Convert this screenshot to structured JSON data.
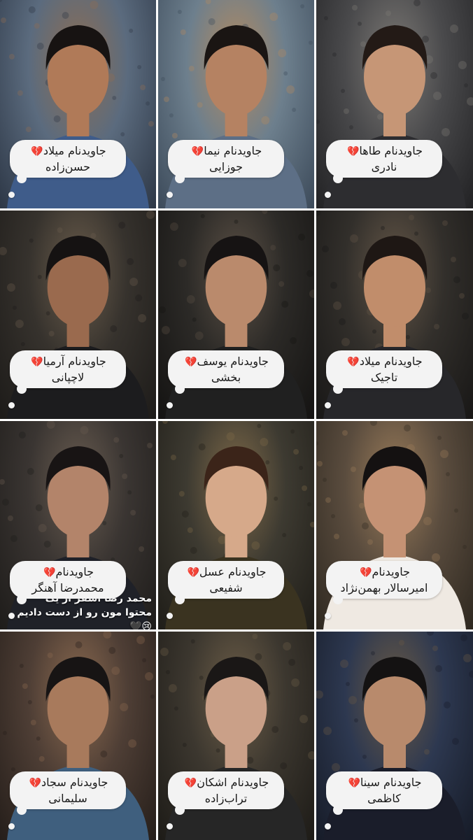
{
  "heart_emoji": "💔",
  "colors": {
    "heart": "#d21f2b",
    "bubble": "#f3f3f3",
    "text": "#1a1a1a"
  },
  "tiles": [
    {
      "line1": "جاویدنام میلاد",
      "line2": "حسن‌زاده",
      "bg": [
        "#5b6b7e",
        "#8e6e52",
        "#2d3746"
      ],
      "skin": "#b07a58",
      "hair": "#171312",
      "shirt": "#3f5c8a"
    },
    {
      "line1": "جاویدنام نیما",
      "line2": "جوزایی",
      "bg": [
        "#6d7f8d",
        "#b48a5e",
        "#3c4a5a"
      ],
      "skin": "#b58262",
      "hair": "#1a1513",
      "shirt": "#5d6f86"
    },
    {
      "line1": "جاویدنام طاها",
      "line2": "نادری",
      "bg": [
        "#4a4a4c",
        "#7d7a76",
        "#222224"
      ],
      "skin": "#c69676",
      "hair": "#231a16",
      "shirt": "#2d2d30"
    },
    {
      "line1": "جاویدنام آرمیا",
      "line2": "لاچپانی",
      "bg": [
        "#36322d",
        "#6b5d4c",
        "#1d1b19"
      ],
      "skin": "#9a6a4e",
      "hair": "#151212",
      "shirt": "#1c1c1e"
    },
    {
      "line1": "جاویدنام یوسف",
      "line2": "بخشی",
      "bg": [
        "#2c2a27",
        "#5c5146",
        "#141312"
      ],
      "skin": "#ba8a6c",
      "hair": "#161313",
      "shirt": "#202020"
    },
    {
      "line1": "جاویدنام میلاد",
      "line2": "تاجیک",
      "bg": [
        "#322f2b",
        "#655748",
        "#181716"
      ],
      "skin": "#c18d6b",
      "hair": "#1e1714",
      "shirt": "#27272a"
    },
    {
      "line1": "جاویدنام",
      "line2": "محمدرضا آهنگر",
      "bg": [
        "#3a3532",
        "#6a5d51",
        "#1e1c1a"
      ],
      "skin": "#b3846a",
      "hair": "#181414",
      "shirt": "#1f2128",
      "overlay": [
        "محمد رضا اسفر از یک",
        "محتوا مون رو از دست دادیم 😢🖤"
      ]
    },
    {
      "line1": "جاویدنام عسل",
      "line2": "شفیعی",
      "bg": [
        "#3d3a31",
        "#7f6a49",
        "#1f1d18"
      ],
      "skin": "#d6a98a",
      "hair": "#3b2419",
      "shirt": "#3a3320"
    },
    {
      "line1": "جاویدنام",
      "line2": "امیرسالار بهمن‌نژاد",
      "bg": [
        "#5a4c3e",
        "#9a7c5a",
        "#2e2820"
      ],
      "skin": "#c59274",
      "hair": "#141111",
      "shirt": "#efe9e2"
    },
    {
      "line1": "جاویدنام سجاد",
      "line2": "سلیمانی",
      "bg": [
        "#4e3e35",
        "#8b6a50",
        "#251e1a"
      ],
      "skin": "#a87a5c",
      "hair": "#171414",
      "shirt": "#3f5f7e"
    },
    {
      "line1": "جاویدنام اشکان",
      "line2": "تراب‌زاده",
      "bg": [
        "#3c372f",
        "#6d5e48",
        "#1d1b17"
      ],
      "skin": "#caa088",
      "hair": "#1a1716",
      "shirt": "#262626"
    },
    {
      "line1": "جاویدنام سینا",
      "line2": "کاظمی",
      "bg": [
        "#2d3850",
        "#6a5a44",
        "#161b27"
      ],
      "skin": "#b88a6c",
      "hair": "#141212",
      "shirt": "#1a1d2a"
    }
  ]
}
